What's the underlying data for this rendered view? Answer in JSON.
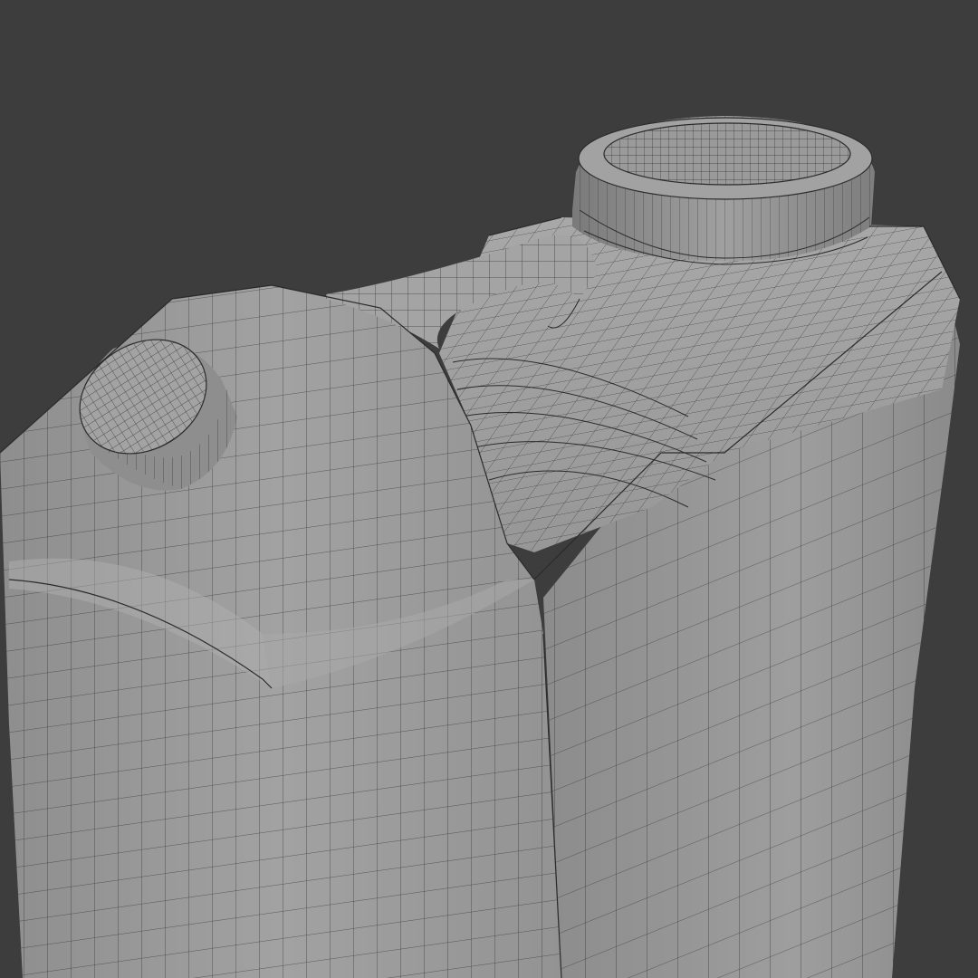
{
  "viewport": {
    "background_color": "#3d3d3d",
    "shading": "solid",
    "wireframe_overlay": true
  },
  "object": {
    "kind": "jerrycan",
    "body_color": "#9c9c9c",
    "body_shadow_color": "#7c7c7c",
    "wire_color": "#2b2b2b",
    "cap_color": "#8a8a8a",
    "parts": [
      "body",
      "handle",
      "large-cap",
      "small-cap"
    ]
  }
}
